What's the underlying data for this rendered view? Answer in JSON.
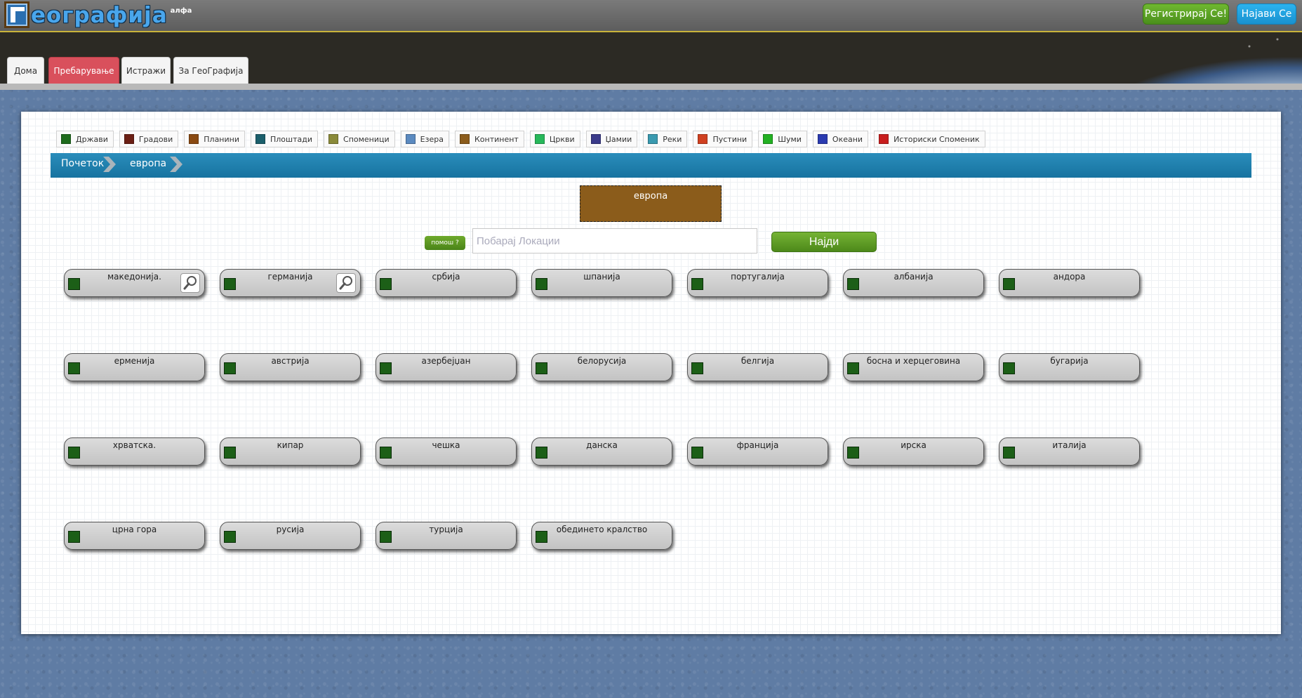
{
  "header": {
    "logo_text": "еографија",
    "logo_badge": "алфа",
    "register_label": "Регистрирај Се!",
    "login_label": "Најави Се"
  },
  "nav": {
    "tabs": [
      {
        "label": "Дома"
      },
      {
        "label": "Пребарување",
        "active": true
      },
      {
        "label": "Истражи"
      },
      {
        "label": "За ГеоГрафија"
      }
    ]
  },
  "legend": [
    {
      "label": "Држави",
      "color": "#1e6b1c"
    },
    {
      "label": "Градови",
      "color": "#6b1f14"
    },
    {
      "label": "Планини",
      "color": "#8a4a12"
    },
    {
      "label": "Плоштади",
      "color": "#1b5f6b"
    },
    {
      "label": "Споменици",
      "color": "#8a8a3a"
    },
    {
      "label": "Езера",
      "color": "#5b8ac0"
    },
    {
      "label": "Континент",
      "color": "#8b5c1b"
    },
    {
      "label": "Цркви",
      "color": "#27b85a"
    },
    {
      "label": "Џамии",
      "color": "#3a3a8a"
    },
    {
      "label": "Реки",
      "color": "#3a9ab0"
    },
    {
      "label": "Пустини",
      "color": "#d04020"
    },
    {
      "label": "Шуми",
      "color": "#22b022"
    },
    {
      "label": "Океани",
      "color": "#2a3ab0"
    },
    {
      "label": "Историски Споменик",
      "color": "#c81e1e"
    }
  ],
  "breadcrumb": {
    "items": [
      "Почеток",
      "европа"
    ]
  },
  "continent": {
    "label": "европа",
    "color": "#8b5c1b"
  },
  "search": {
    "help_label": "помош ?",
    "placeholder": "Побарај Локации",
    "value": "",
    "find_label": "Најди"
  },
  "locations": [
    {
      "label": "македонија.",
      "zoom": true
    },
    {
      "label": "германија",
      "zoom": true
    },
    {
      "label": "србија"
    },
    {
      "label": "шпанија"
    },
    {
      "label": "португалија"
    },
    {
      "label": "албанија"
    },
    {
      "label": "андора"
    },
    {
      "label": "ерменија"
    },
    {
      "label": "австрија"
    },
    {
      "label": "азербејџан"
    },
    {
      "label": "белорусија"
    },
    {
      "label": "белгија"
    },
    {
      "label": "босна и херцеговина"
    },
    {
      "label": "бугарија"
    },
    {
      "label": "хрватска."
    },
    {
      "label": "кипар"
    },
    {
      "label": "чешка"
    },
    {
      "label": "данска"
    },
    {
      "label": "франција"
    },
    {
      "label": "ирска"
    },
    {
      "label": "италија"
    },
    {
      "label": "црна гора"
    },
    {
      "label": "русија"
    },
    {
      "label": "турција"
    },
    {
      "label": "обединето кралство"
    }
  ],
  "icons": {
    "card_type": "country-square-icon",
    "zoom": "magnifier-icon",
    "crumb_separator": "chevron-right-icon"
  }
}
